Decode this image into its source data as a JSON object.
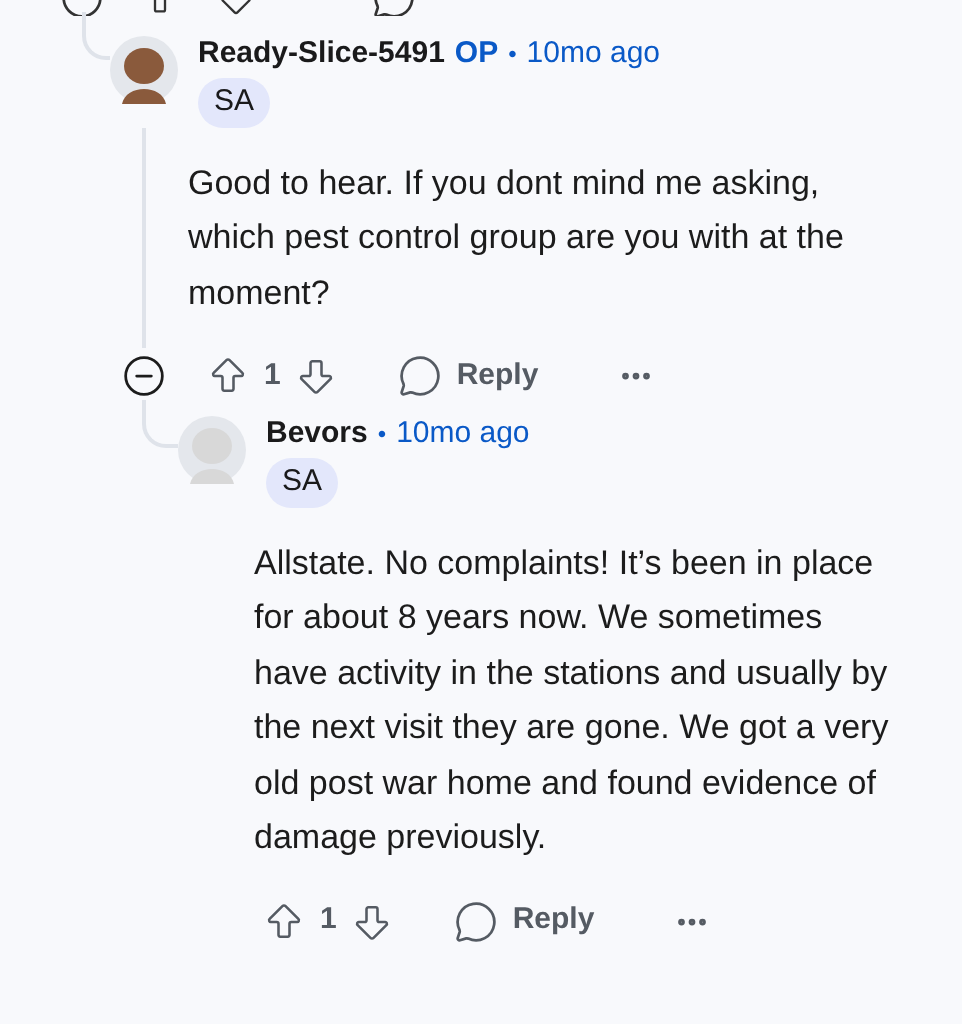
{
  "comments": [
    {
      "author": "Ready-Slice-5491",
      "op_badge": "OP",
      "separator": "•",
      "time": "10mo ago",
      "flair": "SA",
      "body": "Good to hear. If you dont mind me asking, which pest control group are you with at the moment?",
      "votes": "1",
      "reply_label": "Reply",
      "collapsed": false,
      "replies": [
        {
          "author": "Bevors",
          "separator": "•",
          "time": "10mo ago",
          "flair": "SA",
          "body": "Allstate. No complaints! It’s been in place for about 8 years now. We sometimes have activity in the stations and usually by the next visit they are gone. We got a very old post war home and found evidence of damage previously.",
          "votes": "1",
          "reply_label": "Reply"
        }
      ]
    }
  ]
}
